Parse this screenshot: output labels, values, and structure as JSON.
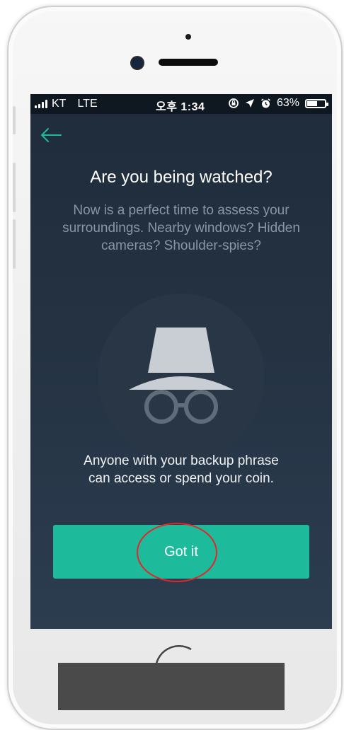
{
  "status_bar": {
    "carrier": "KT",
    "network": "LTE",
    "time": "오후 1:34",
    "battery": "63%",
    "battery_level": 0.63
  },
  "screen": {
    "title": "Are you being watched?",
    "description": "Now is a perfect time to assess your surroundings. Nearby windows? Hidden cameras? Shoulder-spies?",
    "note": "Anyone with your backup phrase can access or spend your coin.",
    "button_label": "Got it"
  },
  "colors": {
    "accent": "#1dbb9b",
    "background_top": "#1f2c3b",
    "annotation_circle": "#e3262b"
  },
  "icons": [
    "back-arrow-icon",
    "spy-incognito-icon",
    "signal-icon",
    "lock-rotation-icon",
    "location-icon",
    "alarm-icon",
    "battery-icon"
  ]
}
